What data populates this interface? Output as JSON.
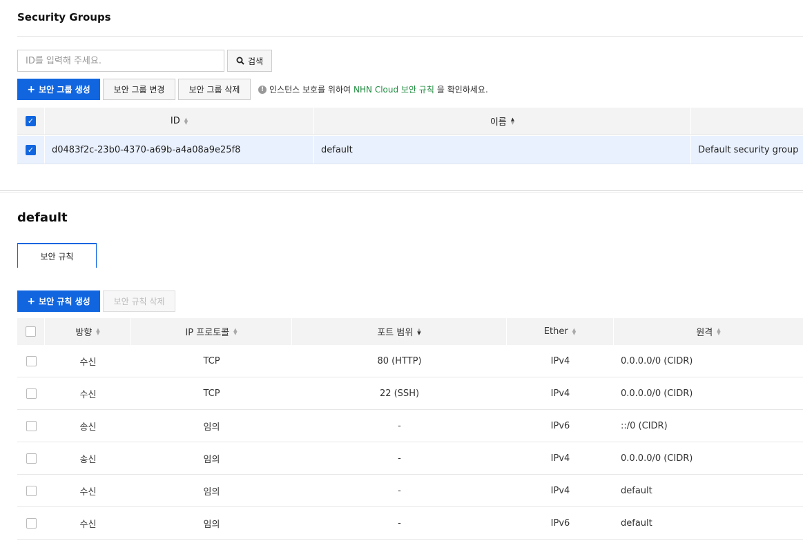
{
  "page_title": "Security Groups",
  "search": {
    "placeholder": "ID를 입력해 주세요.",
    "button_label": "검색"
  },
  "toolbar": {
    "create_label": "보안 그룹 생성",
    "edit_label": "보안 그룹 변경",
    "delete_label": "보안 그룹 삭제",
    "notice_before": "인스턴스 보호를 위하여 ",
    "notice_link": "NHN Cloud 보안 규칙",
    "notice_after": "을 확인하세요."
  },
  "groups_table": {
    "columns": [
      "ID",
      "이름",
      ""
    ],
    "rows": [
      {
        "id": "d0483f2c-23b0-4370-a69b-a4a08a9e25f8",
        "name": "default",
        "description": "Default security group",
        "checked": true
      }
    ]
  },
  "detail": {
    "title": "default",
    "tab_label": "보안 규칙",
    "create_rule_label": "보안 규칙 생성",
    "delete_rule_label": "보안 규칙 삭제"
  },
  "rules_table": {
    "columns": [
      "방향",
      "IP 프로토콜",
      "포트 범위",
      "Ether",
      "원격"
    ],
    "rows": [
      {
        "direction": "수신",
        "protocol": "TCP",
        "port": "80 (HTTP)",
        "ether": "IPv4",
        "remote": "0.0.0.0/0 (CIDR)"
      },
      {
        "direction": "수신",
        "protocol": "TCP",
        "port": "22 (SSH)",
        "ether": "IPv4",
        "remote": "0.0.0.0/0 (CIDR)"
      },
      {
        "direction": "송신",
        "protocol": "임의",
        "port": "-",
        "ether": "IPv6",
        "remote": "::/0 (CIDR)"
      },
      {
        "direction": "송신",
        "protocol": "임의",
        "port": "-",
        "ether": "IPv4",
        "remote": "0.0.0.0/0 (CIDR)"
      },
      {
        "direction": "수신",
        "protocol": "임의",
        "port": "-",
        "ether": "IPv4",
        "remote": "default"
      },
      {
        "direction": "수신",
        "protocol": "임의",
        "port": "-",
        "ether": "IPv6",
        "remote": "default"
      }
    ]
  },
  "colors": {
    "primary": "#1166e0",
    "selected_row": "#e9f1fe",
    "link": "#1e8a3e"
  }
}
